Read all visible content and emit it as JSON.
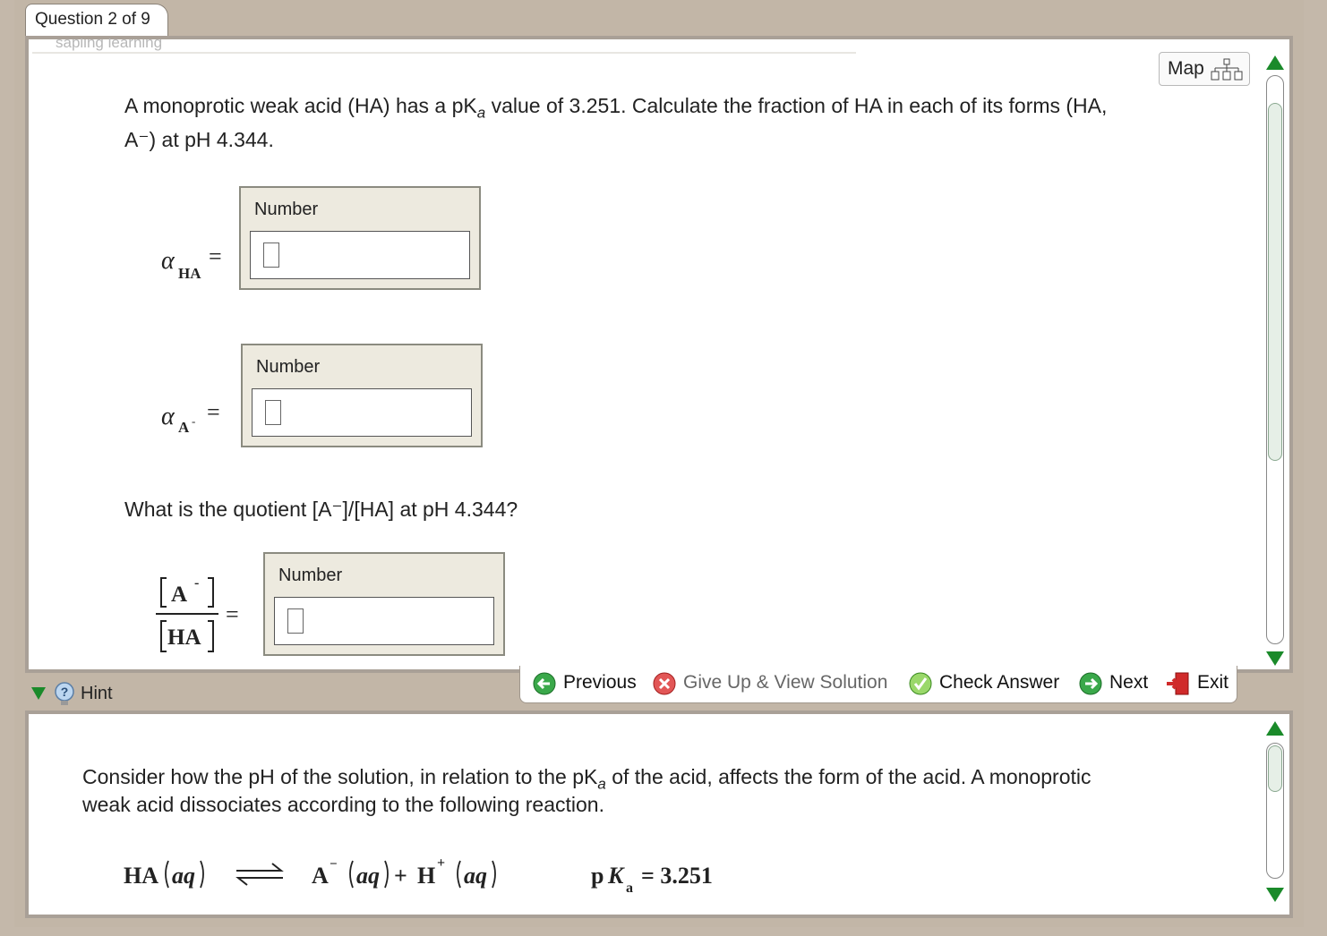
{
  "tab": {
    "title": "Question 2 of 9"
  },
  "header": {
    "logo_text": "sapling learning",
    "map_label": "Map"
  },
  "question": {
    "line1": "A monoprotic weak acid (HA) has a pK",
    "line1_sub": "a",
    "line1_rest": " value of 3.251. Calculate the fraction of HA in each of its forms (HA,",
    "line2": "A⁻) at pH 4.344.",
    "alpha_symbol": "α",
    "alpha_ha_sub": "HA",
    "alpha_a_sub": "A",
    "alpha_a_sup": "-",
    "equals": "=",
    "quotient_question": "What is the quotient [A⁻]/[HA] at pH 4.344?",
    "frac_num": "A",
    "frac_num_sup": "-",
    "frac_den": "HA",
    "number_label": "Number"
  },
  "nav": {
    "previous": "Previous",
    "give_up": "Give Up & View Solution",
    "check": "Check Answer",
    "next": "Next",
    "exit": "Exit"
  },
  "hint": {
    "label": "Hint",
    "line1_a": "Consider how the pH of the solution, in relation to the pK",
    "line1_sub": "a",
    "line1_b": " of the acid, affects the form of the acid. A monoprotic",
    "line2": "weak acid dissociates according to the following reaction.",
    "eq_left": "HA",
    "eq_aq": "aq",
    "eq_a": "A",
    "eq_a_sup": "−",
    "eq_plus": "+",
    "eq_h": "H",
    "eq_h_sup": "+",
    "pka_p": "p",
    "pka_k": "K",
    "pka_sub": "a",
    "pka_value": "= 3.251"
  },
  "colors": {
    "frame": "#c2b6a7",
    "scroll_green": "#1a8a2a",
    "answer_bg": "#edeadf"
  },
  "icons": [
    "map-hierarchy-icon",
    "previous-arrow-icon",
    "give-up-x-icon",
    "check-icon",
    "next-arrow-icon",
    "exit-door-icon",
    "hint-lightbulb-icon",
    "expand-triangle-icon"
  ]
}
